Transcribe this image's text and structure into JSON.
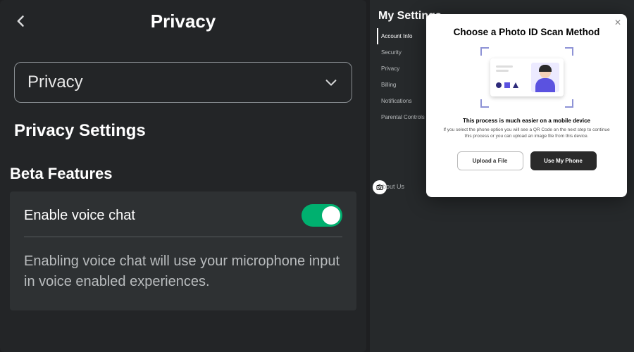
{
  "mobile": {
    "header_title": "Privacy",
    "dropdown_value": "Privacy",
    "section_title_1": "Privacy Settings",
    "section_title_2": "Beta Features",
    "voice_chat": {
      "label": "Enable voice chat",
      "enabled": true,
      "description": "Enabling voice chat will use your microphone input in voice enabled experiences."
    }
  },
  "desktop": {
    "panel_title": "My Settings",
    "sidebar_items": [
      {
        "label": "Account Info",
        "active": true
      },
      {
        "label": "Security",
        "active": false
      },
      {
        "label": "Privacy",
        "active": false
      },
      {
        "label": "Billing",
        "active": false
      },
      {
        "label": "Notifications",
        "active": false
      },
      {
        "label": "Parental Controls",
        "active": false
      }
    ],
    "footer_about": "About Us"
  },
  "modal": {
    "title": "Choose a Photo ID Scan Method",
    "subtitle": "This process is much easier on a mobile device",
    "body": "If you select the phone option you will see a QR Code on the next step to continue this process or you can upload an image file from this device.",
    "button_upload": "Upload a File",
    "button_phone": "Use My Phone"
  }
}
